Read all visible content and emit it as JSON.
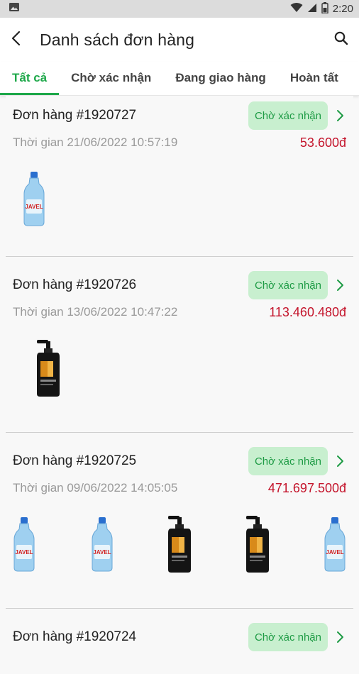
{
  "status_bar": {
    "time": "2:20"
  },
  "header": {
    "title": "Danh sách đơn hàng"
  },
  "tabs": [
    {
      "label": "Tất cả"
    },
    {
      "label": "Chờ xác nhận"
    },
    {
      "label": "Đang giao hàng"
    },
    {
      "label": "Hoàn tất"
    }
  ],
  "orders": [
    {
      "id": "Đơn hàng #1920727",
      "status": "Chờ xác nhận",
      "time": "Thời gian 21/06/2022 10:57:19",
      "total": "53.600đ",
      "products": [
        "bleach-bottle"
      ]
    },
    {
      "id": "Đơn hàng #1920726",
      "status": "Chờ xác nhận",
      "time": "Thời gian 13/06/2022 10:47:22",
      "total": "113.460.480đ",
      "products": [
        "shampoo-pump-bottle"
      ]
    },
    {
      "id": "Đơn hàng #1920725",
      "status": "Chờ xác nhận",
      "time": "Thời gian 09/06/2022 14:05:05",
      "total": "471.697.500đ",
      "products": [
        "bleach-bottle",
        "bleach-bottle",
        "shampoo-pump-bottle",
        "shampoo-pump-bottle",
        "bleach-bottle"
      ]
    },
    {
      "id": "Đơn hàng #1920724",
      "status": "Chờ xác nhận",
      "time": "",
      "total": "",
      "products": []
    }
  ],
  "colors": {
    "accent": "#1ea84a",
    "badge_bg": "#c8efcf",
    "price": "#c4142b"
  }
}
